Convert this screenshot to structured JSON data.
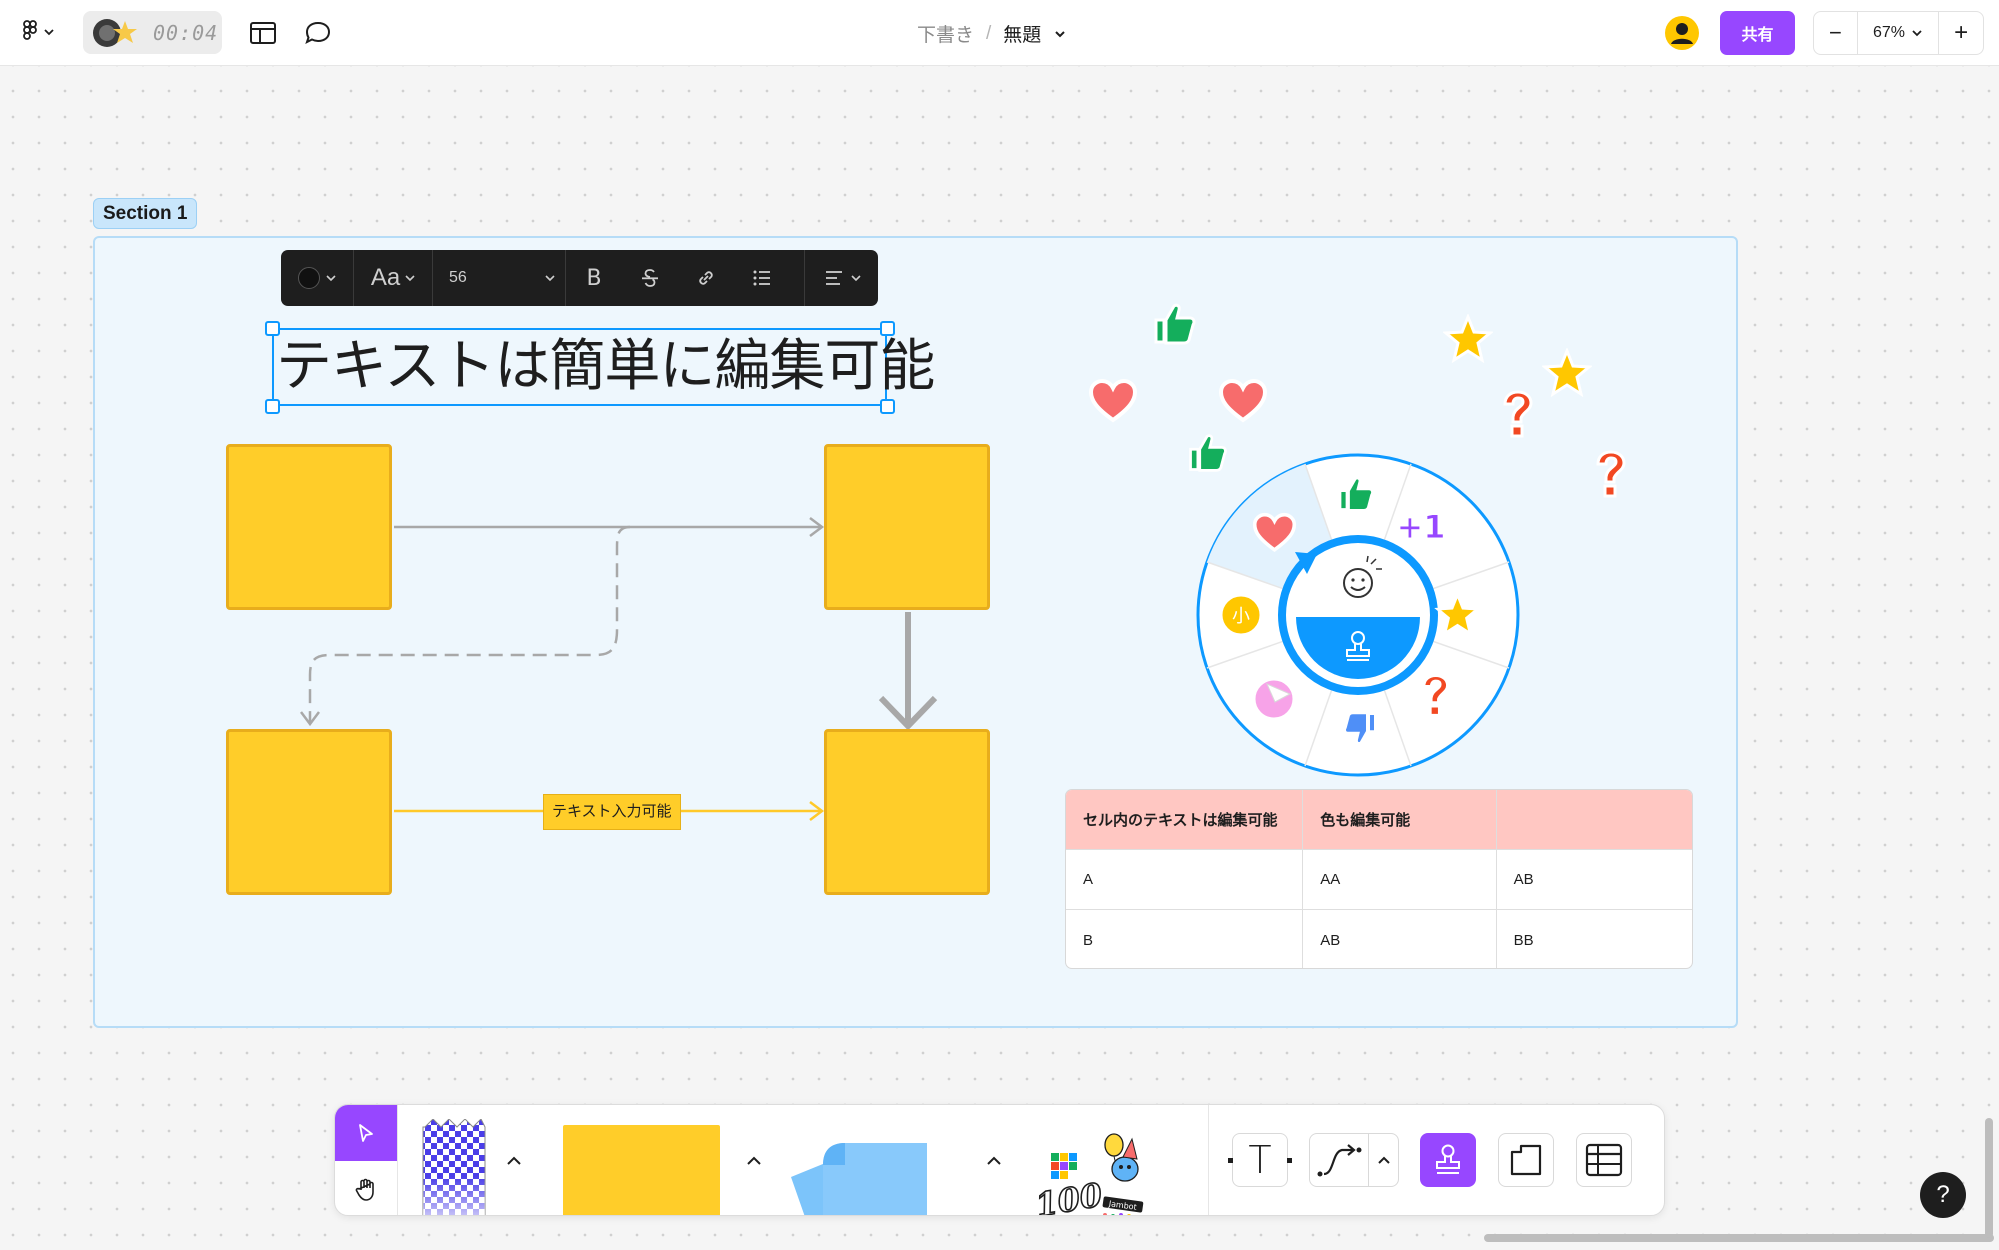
{
  "topbar": {
    "timer": "00:04",
    "breadcrumb": {
      "parent": "下書き",
      "separator": "/",
      "title": "無題"
    },
    "share_label": "共有",
    "zoom_label": "67%",
    "zoom_out_label": "−",
    "zoom_in_label": "+"
  },
  "canvas": {
    "section_label": "Section 1",
    "text_toolbar": {
      "font_glyph": "Aa",
      "font_size": "56",
      "bold_label": "B"
    },
    "heading": "テキストは簡単に編集可能",
    "connector_label": "テキスト入力可能"
  },
  "reaction_wheel": {
    "center_top_icon": "smiley-icon",
    "center_bottom_icon": "stamp-icon",
    "items": [
      "thumbs-up",
      "plus-one",
      "star",
      "question-mark",
      "thumbs-down",
      "sticker-peel",
      "small-badge",
      "heart"
    ],
    "plus_one_label": "+1",
    "small_badge_label": "小"
  },
  "table": {
    "headers": [
      "セル内のテキストは編集可能",
      "色も編集可能",
      ""
    ],
    "rows": [
      [
        "A",
        "AA",
        "AB"
      ],
      [
        "B",
        "AB",
        "BB"
      ]
    ],
    "header_color": "#ffc7c2"
  },
  "bottom_toolbar": {
    "text_tool_glyph": "T",
    "sticker_badge_text": "100",
    "widget_tag": "Jambot"
  },
  "help_label": "?",
  "colors": {
    "accent": "#9747ff",
    "selection": "#0d99ff",
    "sticky_yellow": "#ffcd29",
    "connector_yellow": "#ffc929",
    "section_fill": "#eef7fd",
    "wheel_center": "#0d99ff"
  }
}
